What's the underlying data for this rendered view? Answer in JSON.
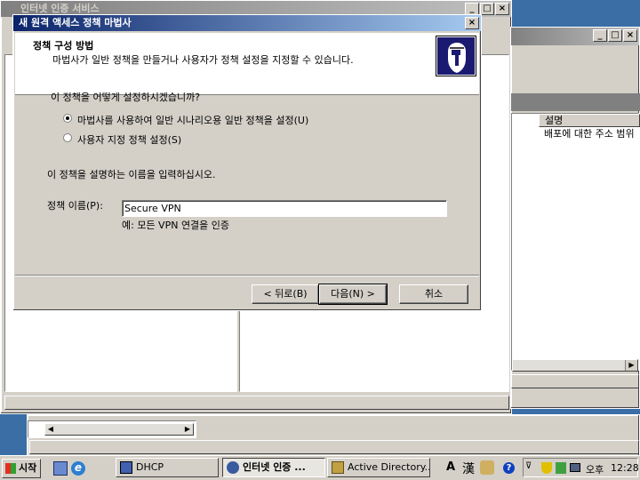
{
  "bg_window": {
    "title": "인터넷 인증 서비스",
    "column_header": "설명",
    "row_text": "배포에 대한 주소 범위"
  },
  "dialog": {
    "title": "새 원격 액세스 정책 마법사",
    "header_title": "정책 구성 방법",
    "header_subtitle": "마법사가 일반 정책을 만들거나 사용자가 정책 설정을 지정할 수 있습니다.",
    "question": "이 정책을 어떻게 설정하시겠습니까?",
    "option_wizard": "마법사를 사용하여 일반 시나리오용 일반 정책을 설정(U)",
    "option_custom": "사용자 지정 정책 설정(S)",
    "name_prompt": "이 정책을 설명하는 이름을 입력하십시오.",
    "name_label": "정책 이름(P):",
    "name_value": "Secure VPN",
    "example": "예: 모든 VPN 연결을 인증",
    "back_button": "< 뒤로(B)",
    "next_button": "다음(N) >",
    "cancel_button": "취소"
  },
  "taskbar": {
    "start": "시작",
    "tasks": [
      "DHCP",
      "인터넷 인증 ...",
      "Active Directory..."
    ],
    "active_task": 1,
    "lang": "A",
    "hanja": "漢",
    "clock_ampm": "오후",
    "clock_time": "12:28"
  },
  "colors": {
    "desktop": "#3a6ea5",
    "active_title": "#0a246a",
    "face": "#d4d0c8"
  }
}
